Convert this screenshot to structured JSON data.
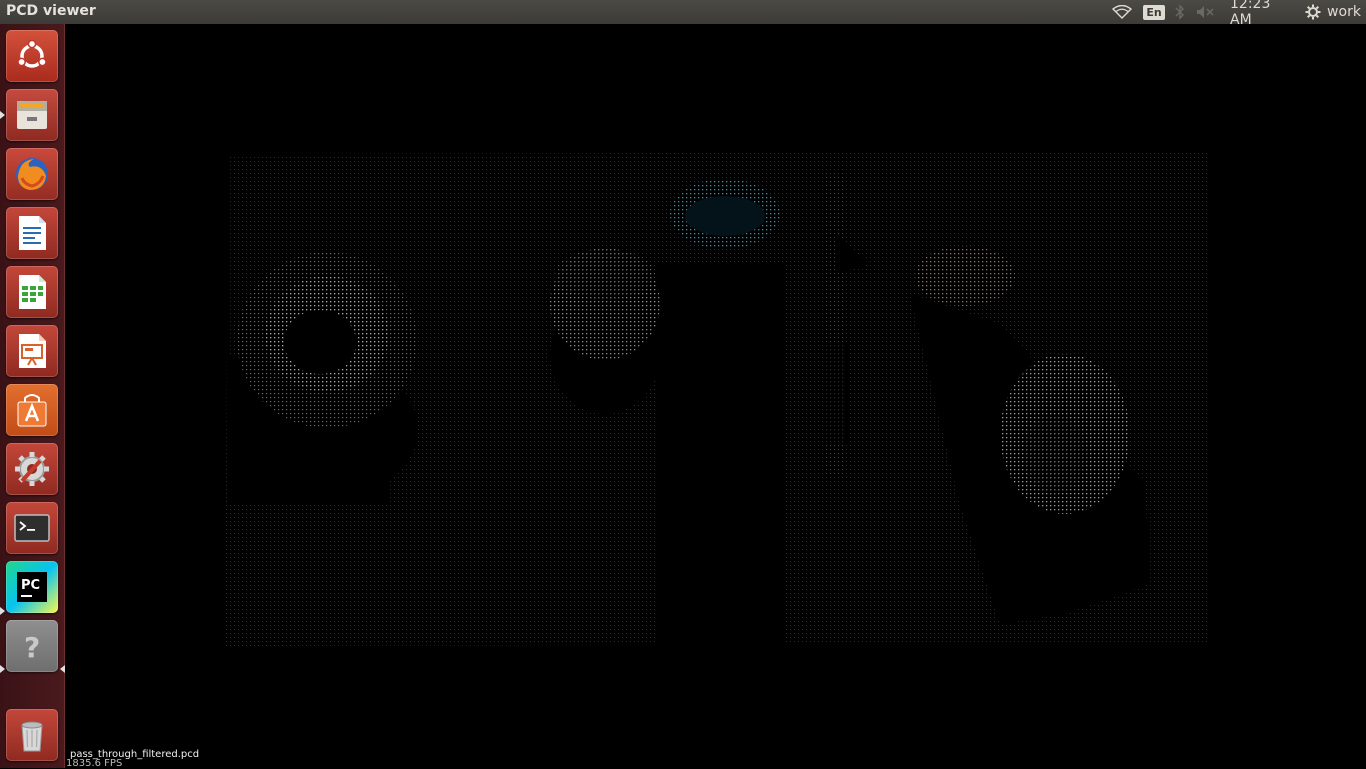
{
  "window": {
    "title": "PCD viewer"
  },
  "panel": {
    "wifi_icon": "wifi-icon",
    "keyboard_layout": "En",
    "bluetooth_icon": "bluetooth-icon",
    "volume_icon": "volume-muted-icon",
    "clock": "12:23 AM",
    "session_icon": "gear-icon",
    "session_label": "work"
  },
  "launcher": {
    "items": [
      {
        "name": "ubuntu-dash",
        "icon": "ubuntu-logo-icon",
        "running": false
      },
      {
        "name": "files",
        "icon": "file-cabinet-icon",
        "running": true
      },
      {
        "name": "firefox",
        "icon": "firefox-icon",
        "running": false
      },
      {
        "name": "libreoffice-writer",
        "icon": "writer-document-icon",
        "running": false
      },
      {
        "name": "libreoffice-calc",
        "icon": "calc-spreadsheet-icon",
        "running": false
      },
      {
        "name": "libreoffice-impress",
        "icon": "impress-presentation-icon",
        "running": false
      },
      {
        "name": "software-center",
        "icon": "shopping-bag-icon",
        "running": false
      },
      {
        "name": "system-settings",
        "icon": "settings-wrench-icon",
        "running": false
      },
      {
        "name": "terminal",
        "icon": "terminal-icon",
        "running": false
      },
      {
        "name": "pycharm",
        "icon": "pycharm-icon",
        "running": true
      },
      {
        "name": "pcd-viewer",
        "icon": "unknown-app-icon",
        "running": true,
        "focused": true
      },
      {
        "name": "trash",
        "icon": "trash-icon",
        "running": false
      }
    ]
  },
  "viewer": {
    "cloud_filename": "pass_through_filtered.pcd",
    "fps_text": "1835.6 FPS",
    "colors": {
      "background": "#000000",
      "points": "#c8c8c8",
      "accent_points": "#3a8fb5"
    }
  }
}
